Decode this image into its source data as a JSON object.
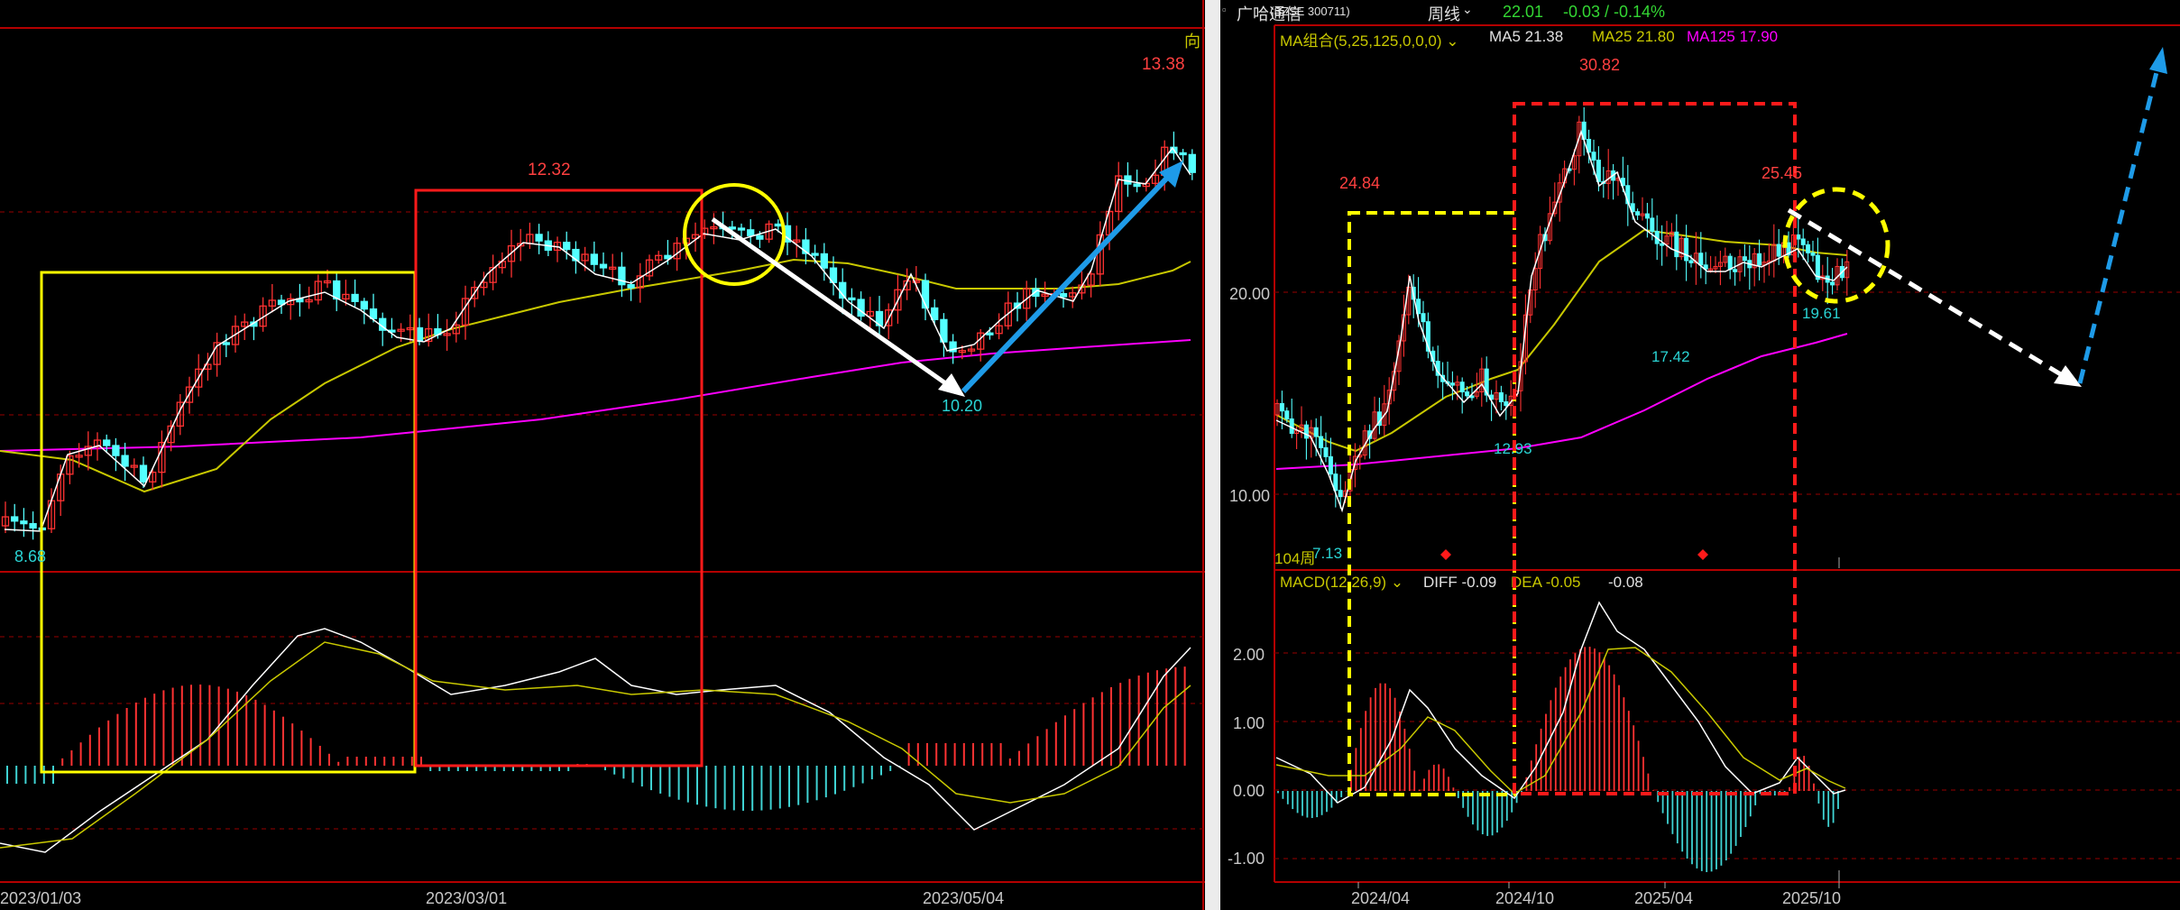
{
  "left": {
    "corner_label": "向",
    "chart_data": {
      "type": "candlestick",
      "x_ticks": [
        "2023/01/03",
        "2023/03/01",
        "2023/05/04"
      ],
      "price_annotations": {
        "low_start": "8.68",
        "mid_high": "12.32",
        "pullback_low": "10.20",
        "high": "13.38"
      },
      "series": [
        {
          "name": "MA5"
        },
        {
          "name": "MA25"
        },
        {
          "name": "MA125"
        }
      ],
      "indicator": "MACD",
      "annotations": [
        "yellow box: base",
        "red box: consolidation",
        "yellow circle: top",
        "white arrow: decline to 10.20",
        "blue arrow: rise to 13.38"
      ]
    }
  },
  "right": {
    "header": {
      "stock_name": "广哈通信",
      "code": "SZSE 300711",
      "period": "周线",
      "price": "22.01",
      "change": "-0.03 / -0.14%"
    },
    "ma_legend": {
      "title": "MA组合(5,25,125,0,0,0)",
      "ma5": "MA5 21.38",
      "ma25": "MA25 21.80",
      "ma125": "MA125 17.90"
    },
    "macd_legend": {
      "title": "MACD(12,26,9)",
      "diff": "DIFF -0.09",
      "dea": "DEA -0.05",
      "macd": "-0.08"
    },
    "period_count": "104周",
    "chart_data": {
      "type": "candlestick",
      "price_axis": {
        "ticks": [
          "20.00",
          "10.00"
        ]
      },
      "macd_axis": {
        "ticks": [
          "2.00",
          "1.00",
          "0.00",
          "-1.00"
        ]
      },
      "x_ticks": [
        "2024/04",
        "2024/10",
        "2025/04",
        "2025/10"
      ],
      "price_annotations": {
        "low": "7.13",
        "high1": "24.84",
        "low2": "12.93",
        "peak": "30.82",
        "low3": "17.42",
        "high3": "25.45",
        "last_low": "19.61"
      },
      "annotations": [
        "yellow dashed box",
        "red dashed box",
        "yellow dashed circle",
        "white dashed arrow down",
        "blue dashed arrow up"
      ]
    }
  },
  "colors": {
    "up": "#ff3232",
    "down": "#54ffff",
    "ma5": "#ffffff",
    "ma25": "#c8c800",
    "ma125": "#ff00ff",
    "grid": "#8a0000",
    "yellow": "#ffff00",
    "red": "#ff1a1a",
    "blue": "#1e9be8",
    "white": "#ffffff",
    "label_red": "#ff4040",
    "label_cyan": "#2ad4d4"
  }
}
